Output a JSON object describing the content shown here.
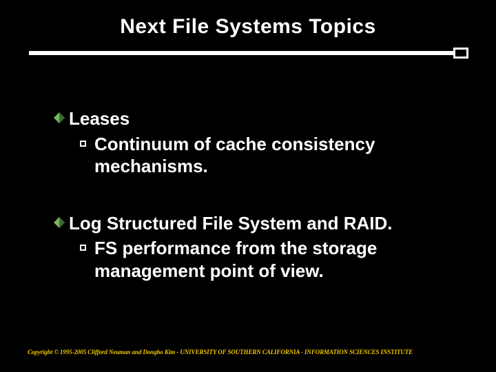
{
  "title": "Next File Systems Topics",
  "topics": [
    {
      "heading": "Leases",
      "sub": "Continuum of cache consistency mechanisms."
    },
    {
      "heading": "Log Structured File System and RAID.",
      "sub": "FS performance from the storage management point of view."
    }
  ],
  "footer": "Copyright © 1995-2005 Clifford Neuman and Dongho Kim - UNIVERSITY OF SOUTHERN CALIFORNIA - INFORMATION SCIENCES INSTITUTE"
}
